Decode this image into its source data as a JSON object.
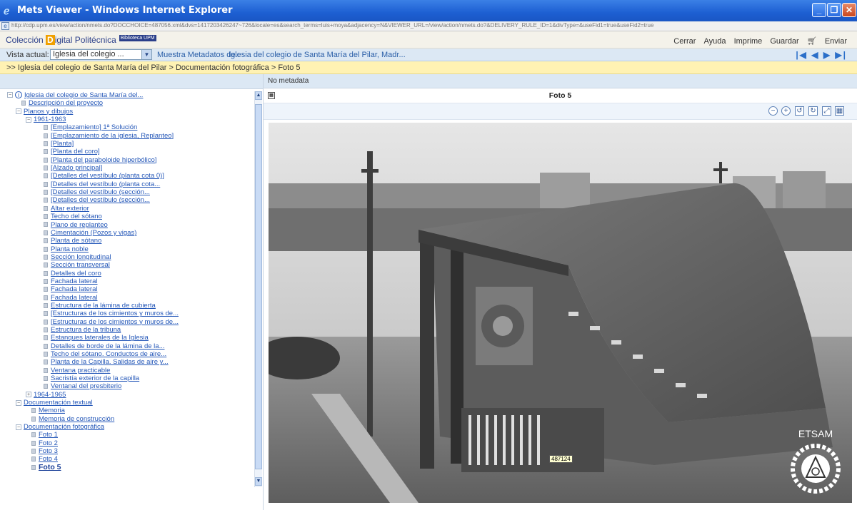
{
  "window": {
    "title": "Mets Viewer - Windows Internet Explorer",
    "url": "http://cdp.upm.es/view/action/nmets.do?DOCCHOICE=487056.xml&dvs=1417203426247~726&locale=es&search_terms=luis+moya&adjacency=N&VIEWER_URL=/view/action/nmets.do?&DELIVERY_RULE_ID=1&divType=&useFid1=true&useFid2=true"
  },
  "header": {
    "logo_part1": "Colección ",
    "logo_d": "D",
    "logo_part2": "igital Politécnica",
    "logo_badge": "Biblioteca UPM",
    "menu": [
      "Cerrar",
      "Ayuda",
      "Imprime",
      "Guardar",
      "Enviar"
    ]
  },
  "selectbar": {
    "label": "Vista actual:",
    "selected": "Iglesia del colegio ...",
    "meta_label": "Muestra Metadatos de.:",
    "meta_value": "Iglesia del colegio de Santa María del Pilar, Madr..."
  },
  "breadcrumb": ">> Iglesia del colegio de Santa María del Pilar > Documentación fotográfica > Foto 5",
  "tree": [
    {
      "label": "Iglesia del colegio de Santa María del...",
      "level": 0,
      "type": "root"
    },
    {
      "label": "Descripción del proyecto",
      "level": 1,
      "type": "doc"
    },
    {
      "label": "Planos y dibujos",
      "level": 1,
      "type": "folder"
    },
    {
      "label": "1961-1963",
      "level": 2,
      "type": "folder"
    },
    {
      "label": "[Emplazamiento] 1ª Solución",
      "level": 3,
      "type": "doc"
    },
    {
      "label": "[Emplazamiento de la iglesia, Replanteo]",
      "level": 3,
      "type": "doc"
    },
    {
      "label": "[Planta]",
      "level": 3,
      "type": "doc"
    },
    {
      "label": "[Planta del coro]",
      "level": 3,
      "type": "doc"
    },
    {
      "label": "[Planta del paraboloide hiperbólico]",
      "level": 3,
      "type": "doc"
    },
    {
      "label": "[Alzado principal]",
      "level": 3,
      "type": "doc"
    },
    {
      "label": "[Detalles del vestíbulo (planta cota 0)]",
      "level": 3,
      "type": "doc"
    },
    {
      "label": "[Detalles del vestíbulo (planta cota...",
      "level": 3,
      "type": "doc"
    },
    {
      "label": "[Detalles del vestíbulo (sección...",
      "level": 3,
      "type": "doc"
    },
    {
      "label": "[Detalles del vestíbulo (sección...",
      "level": 3,
      "type": "doc"
    },
    {
      "label": "Altar exterior",
      "level": 3,
      "type": "doc"
    },
    {
      "label": "Techo del sótano",
      "level": 3,
      "type": "doc"
    },
    {
      "label": "Plano de replanteo",
      "level": 3,
      "type": "doc"
    },
    {
      "label": "Cimentación (Pozos y vigas)",
      "level": 3,
      "type": "doc"
    },
    {
      "label": "Planta de sótano",
      "level": 3,
      "type": "doc"
    },
    {
      "label": "Planta noble",
      "level": 3,
      "type": "doc"
    },
    {
      "label": "Sección longitudinal",
      "level": 3,
      "type": "doc"
    },
    {
      "label": "Sección transversal",
      "level": 3,
      "type": "doc"
    },
    {
      "label": "Detalles del coro",
      "level": 3,
      "type": "doc"
    },
    {
      "label": "Fachada lateral",
      "level": 3,
      "type": "doc"
    },
    {
      "label": "Fachada lateral",
      "level": 3,
      "type": "doc"
    },
    {
      "label": "Fachada lateral",
      "level": 3,
      "type": "doc"
    },
    {
      "label": "Estructura de la lámina de cubierta",
      "level": 3,
      "type": "doc"
    },
    {
      "label": "[Estructuras de los cimientos y muros de...",
      "level": 3,
      "type": "doc"
    },
    {
      "label": "[Estructuras de los cimientos y muros de...",
      "level": 3,
      "type": "doc"
    },
    {
      "label": "Estructura de la tribuna",
      "level": 3,
      "type": "doc"
    },
    {
      "label": "Estanques laterales de la Iglesia",
      "level": 3,
      "type": "doc"
    },
    {
      "label": "Detalles de borde de la lámina de la...",
      "level": 3,
      "type": "doc"
    },
    {
      "label": "Techo del sótano. Conductos de aire...",
      "level": 3,
      "type": "doc"
    },
    {
      "label": "Planta de la Capilla. Salidas de aire y...",
      "level": 3,
      "type": "doc"
    },
    {
      "label": "Ventana practicable",
      "level": 3,
      "type": "doc"
    },
    {
      "label": "Sacristía exterior de la capilla",
      "level": 3,
      "type": "doc"
    },
    {
      "label": "Ventanal del presbiterio",
      "level": 3,
      "type": "doc"
    },
    {
      "label": "1964-1965",
      "level": 2,
      "type": "collapsed"
    },
    {
      "label": "Documentación textual",
      "level": 1,
      "type": "folder"
    },
    {
      "label": "Memoria",
      "level": 2,
      "type": "doc"
    },
    {
      "label": "Memoria de construcción",
      "level": 2,
      "type": "doc"
    },
    {
      "label": "Documentación fotográfica",
      "level": 1,
      "type": "folder"
    },
    {
      "label": "Foto 1",
      "level": 2,
      "type": "doc"
    },
    {
      "label": "Foto 2",
      "level": 2,
      "type": "doc"
    },
    {
      "label": "Foto 3",
      "level": 2,
      "type": "doc"
    },
    {
      "label": "Foto 4",
      "level": 2,
      "type": "doc"
    },
    {
      "label": "Foto 5",
      "level": 2,
      "type": "doc",
      "selected": true
    }
  ],
  "viewer": {
    "no_metadata": "No metadata",
    "caption": "Foto 5",
    "image_id": "487124",
    "watermark": "ETSAM"
  },
  "colors": {
    "titlebar": "#1d5fd2",
    "link": "#2457b8",
    "breadcrumb_bg": "#fff2b3",
    "panel_bg": "#dce8f4"
  }
}
